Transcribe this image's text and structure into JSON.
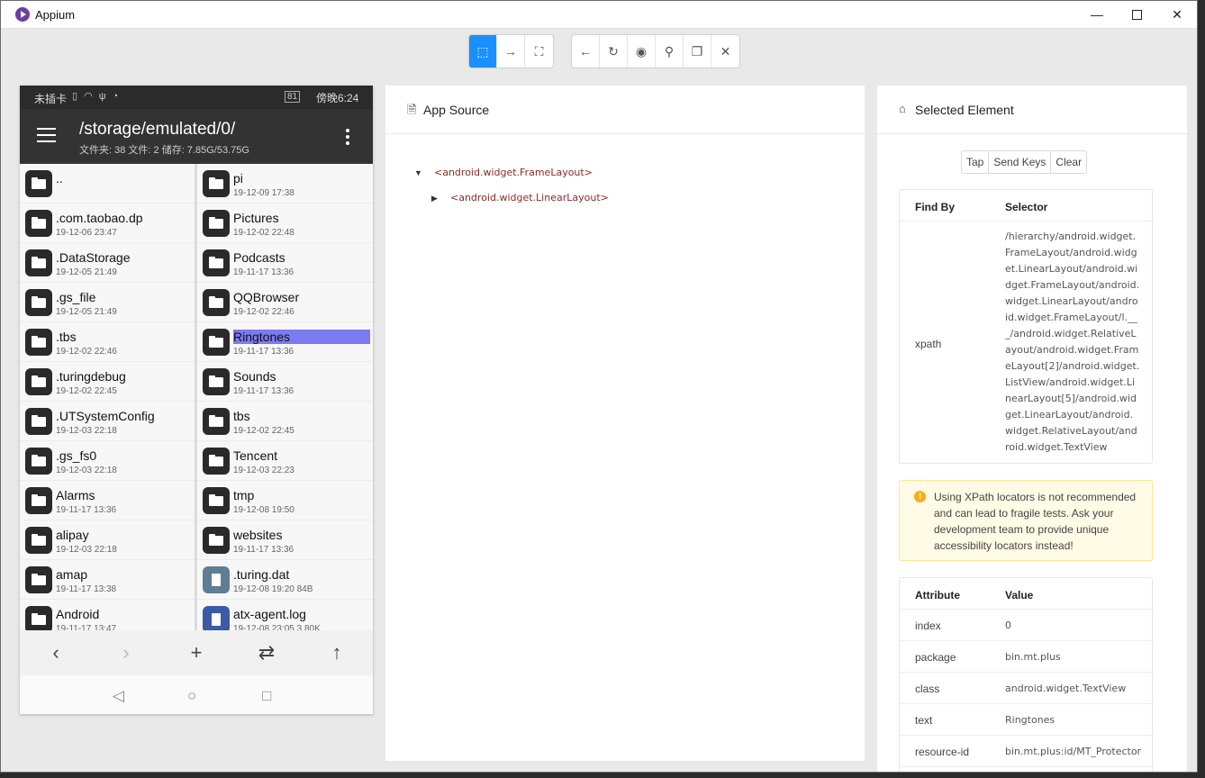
{
  "window": {
    "title": "Appium",
    "minimize": "—",
    "close": "✕"
  },
  "toolbar": {
    "group1": [
      {
        "name": "select-elements-icon",
        "glyph": "⬚"
      },
      {
        "name": "swipe-icon",
        "glyph": "→"
      },
      {
        "name": "tap-coordinates-icon",
        "glyph": "⛶"
      }
    ],
    "group2": [
      {
        "name": "back-icon",
        "glyph": "←"
      },
      {
        "name": "refresh-icon",
        "glyph": "↻"
      },
      {
        "name": "eye-icon",
        "glyph": "◉"
      },
      {
        "name": "search-icon",
        "glyph": "⚲"
      },
      {
        "name": "copy-icon",
        "glyph": "❐"
      },
      {
        "name": "close-icon",
        "glyph": "✕"
      }
    ]
  },
  "phone": {
    "status": {
      "carrier": "未插卡",
      "battery": "81",
      "time": "傍晚6:24"
    },
    "appbar": {
      "path": "/storage/emulated/0/",
      "summary": "文件夹: 38  文件: 2  储存: 7.85G/53.75G"
    },
    "left_files": [
      {
        "name": "..",
        "meta": "",
        "type": "folder"
      },
      {
        "name": ".com.taobao.dp",
        "meta": "19-12-06 23:47",
        "type": "folder"
      },
      {
        "name": ".DataStorage",
        "meta": "19-12-05 21:49",
        "type": "folder"
      },
      {
        "name": ".gs_file",
        "meta": "19-12-05 21:49",
        "type": "folder"
      },
      {
        "name": ".tbs",
        "meta": "19-12-02 22:46",
        "type": "folder"
      },
      {
        "name": ".turingdebug",
        "meta": "19-12-02 22:45",
        "type": "folder"
      },
      {
        "name": ".UTSystemConfig",
        "meta": "19-12-03 22:18",
        "type": "folder"
      },
      {
        "name": ".gs_fs0",
        "meta": "19-12-03 22:18",
        "type": "folder"
      },
      {
        "name": "Alarms",
        "meta": "19-11-17 13:36",
        "type": "folder"
      },
      {
        "name": "alipay",
        "meta": "19-12-03 22:18",
        "type": "folder"
      },
      {
        "name": "amap",
        "meta": "19-11-17 13:38",
        "type": "folder"
      },
      {
        "name": "Android",
        "meta": "19-11-17 13:47",
        "type": "folder"
      }
    ],
    "right_files": [
      {
        "name": "pi",
        "meta": "19-12-09 17:38",
        "type": "folder"
      },
      {
        "name": "Pictures",
        "meta": "19-12-02 22:48",
        "type": "folder"
      },
      {
        "name": "Podcasts",
        "meta": "19-11-17 13:36",
        "type": "folder"
      },
      {
        "name": "QQBrowser",
        "meta": "19-12-02 22:46",
        "type": "folder"
      },
      {
        "name": "Ringtones",
        "meta": "19-11-17 13:36",
        "type": "folder",
        "highlighted": true
      },
      {
        "name": "Sounds",
        "meta": "19-11-17 13:36",
        "type": "folder"
      },
      {
        "name": "tbs",
        "meta": "19-12-02 22:45",
        "type": "folder"
      },
      {
        "name": "Tencent",
        "meta": "19-12-03 22:23",
        "type": "folder"
      },
      {
        "name": "tmp",
        "meta": "19-12-08 19:50",
        "type": "folder"
      },
      {
        "name": "websites",
        "meta": "19-11-17 13:36",
        "type": "folder"
      },
      {
        "name": ".turing.dat",
        "meta": "19-12-08 19:20  84B",
        "type": "file"
      },
      {
        "name": "atx-agent.log",
        "meta": "19-12-08 23:05  3.80K",
        "type": "log"
      }
    ],
    "bottom_nav": [
      "‹",
      "›",
      "+",
      "⇄",
      "↑"
    ],
    "system_nav": [
      "◁",
      "○",
      "□"
    ]
  },
  "source": {
    "title": "App Source",
    "tree": [
      {
        "label": "<android.widget.FrameLayout>",
        "expanded": true
      },
      {
        "label": "<android.widget.LinearLayout>",
        "expanded": false
      }
    ]
  },
  "selected": {
    "title": "Selected Element",
    "actions": [
      "Tap",
      "Send Keys",
      "Clear"
    ],
    "findby": {
      "col1": "Find By",
      "col2": "Selector",
      "strategy": "xpath",
      "selector": "/hierarchy/android.widget.FrameLayout/android.widget.LinearLayout/android.widget.FrameLayout/android.widget.LinearLayout/android.widget.FrameLayout/l.___/android.widget.RelativeLayout/android.widget.FrameLayout[2]/android.widget.ListView/android.widget.LinearLayout[5]/android.widget.LinearLayout/android.widget.RelativeLayout/android.widget.TextView"
    },
    "warning": "Using XPath locators is not recommended and can lead to fragile tests. Ask your development team to provide unique accessibility locators instead!",
    "attributes": {
      "col1": "Attribute",
      "col2": "Value",
      "rows": [
        {
          "key": "index",
          "value": "0"
        },
        {
          "key": "package",
          "value": "bin.mt.plus"
        },
        {
          "key": "class",
          "value": "android.widget.TextView"
        },
        {
          "key": "text",
          "value": "Ringtones"
        },
        {
          "key": "resource-id",
          "value": "bin.mt.plus:id/MT_Protector"
        }
      ]
    }
  }
}
